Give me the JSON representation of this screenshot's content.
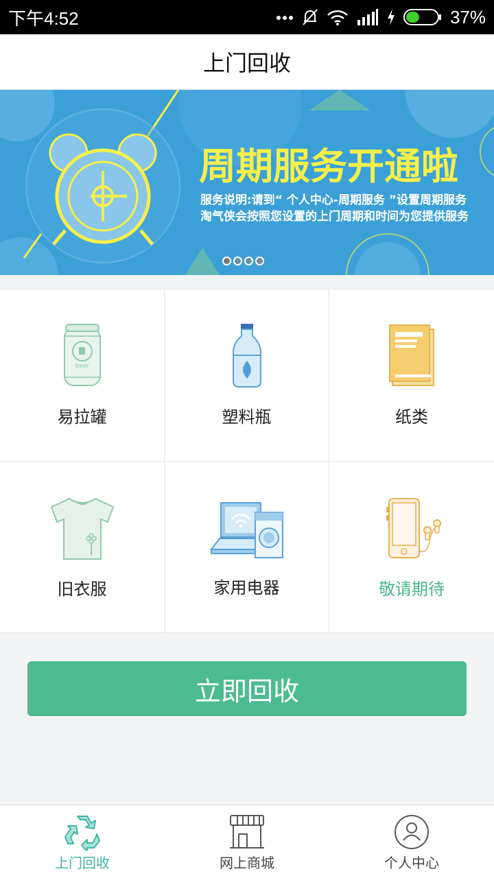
{
  "status_bar": {
    "time": "下午4:52",
    "battery": "37%",
    "icons": [
      "more-dots-icon",
      "mute-bell-icon",
      "wifi-icon",
      "signal-icon",
      "charging-icon",
      "battery-icon"
    ]
  },
  "header": {
    "title": "上门回收"
  },
  "banner": {
    "title": "周期服务开通啦",
    "desc_line1": "服务说明:请到“ 个人中心-周期服务 ”设置周期服务",
    "desc_line2": "淘气侠会按照您设置的上门周期和时间为您提供服务",
    "slide_count": 4,
    "active_slide": 1,
    "colors": {
      "background": "#3ca0d8",
      "title": "#f5f04a"
    }
  },
  "categories": [
    {
      "label": "易拉罐",
      "icon": "can-icon"
    },
    {
      "label": "塑料瓶",
      "icon": "plastic-bottle-icon"
    },
    {
      "label": "纸类",
      "icon": "paper-book-icon"
    },
    {
      "label": "旧衣服",
      "icon": "tshirt-icon"
    },
    {
      "label": "家用电器",
      "icon": "appliances-icon"
    },
    {
      "label": "敬请期待",
      "icon": "phone-earphones-icon"
    }
  ],
  "action": {
    "recycle_label": "立即回收",
    "color": "#4cbb8f"
  },
  "bottom_nav": {
    "items": [
      {
        "label": "上门回收",
        "icon": "recycle-icon",
        "active": true
      },
      {
        "label": "网上商城",
        "icon": "shop-icon",
        "active": false
      },
      {
        "label": "个人中心",
        "icon": "user-icon",
        "active": false
      }
    ],
    "active_color": "#3fb5a4"
  }
}
